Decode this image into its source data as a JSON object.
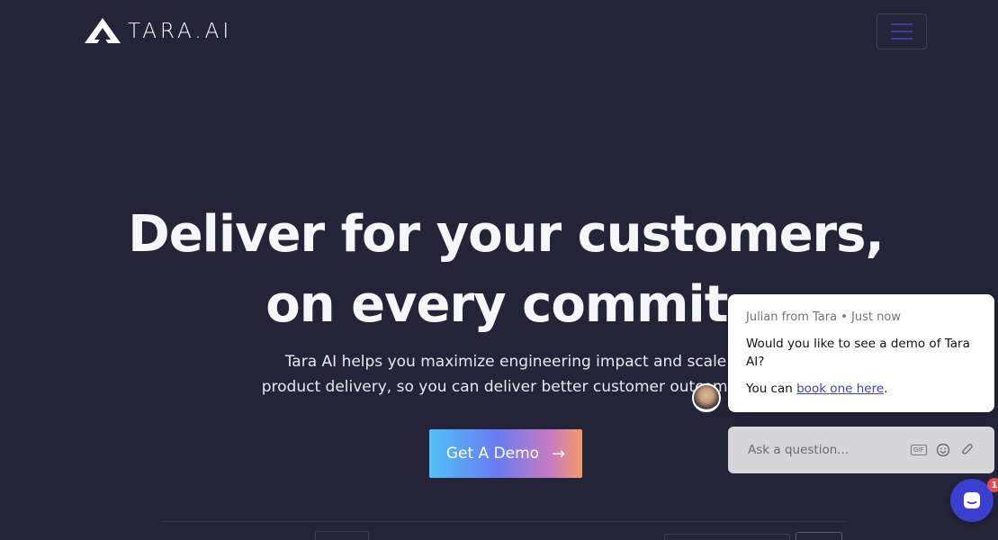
{
  "header": {
    "brand": "TARA.AI",
    "menu_icon": "hamburger-icon"
  },
  "hero": {
    "title_line1": "Deliver for your customers,",
    "title_line2": "on every commit.",
    "subtitle_line1": "Tara AI helps you maximize engineering impact and scale",
    "subtitle_line2": "product delivery, so you can deliver better customer outcomes.",
    "cta_label": "Get A Demo",
    "cta_icon": "arrow-right-icon"
  },
  "chat": {
    "sender": "Julian from Tara",
    "separator": "•",
    "timestamp": "Just now",
    "message": "Would you like to see a demo of Tara AI?",
    "message2_prefix": "You can ",
    "link_text": "book one here",
    "message2_suffix": ".",
    "input_placeholder": "Ask a question...",
    "gif_label": "GIF",
    "launcher_badge": "1"
  },
  "colors": {
    "background": "#232437",
    "cta_gradient_start": "#4fc1f7",
    "cta_gradient_end": "#f59a6a",
    "launcher": "#3b3fcf",
    "badge": "#e34c4c"
  }
}
